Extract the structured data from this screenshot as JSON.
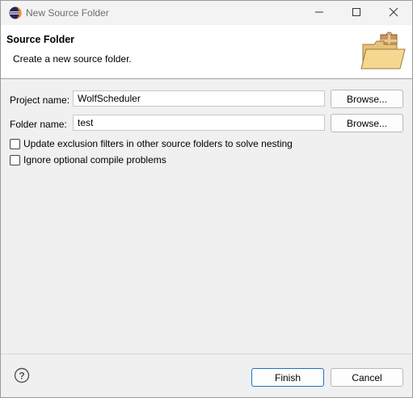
{
  "window": {
    "title": "New Source Folder"
  },
  "banner": {
    "title": "Source Folder",
    "description": "Create a new source folder."
  },
  "form": {
    "project_label": "Project name:",
    "project_value": "WolfScheduler",
    "folder_label": "Folder name:",
    "folder_value": "test",
    "browse_label": "Browse...",
    "checkbox_exclusion": "Update exclusion filters in other source folders to solve nesting",
    "checkbox_exclusion_checked": false,
    "checkbox_ignore": "Ignore optional compile problems",
    "checkbox_ignore_checked": false
  },
  "footer": {
    "finish_label": "Finish",
    "cancel_label": "Cancel"
  },
  "colors": {
    "accent": "#1a73c8",
    "banner_bg": "#ffffff",
    "dialog_bg": "#f0f0f0"
  }
}
